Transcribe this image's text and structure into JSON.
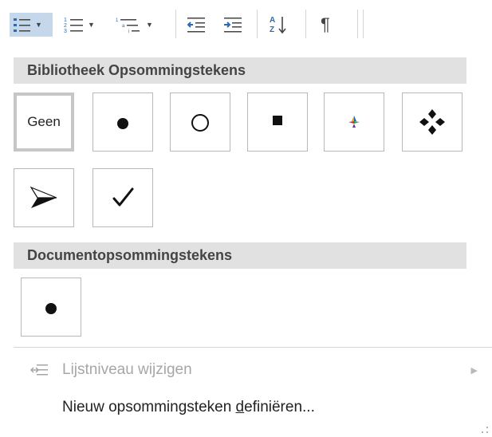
{
  "ribbon": {
    "bullets_button": "Opsommingstekens",
    "numbering_button": "Nummering",
    "multilevel_button": "Lijst met meerdere niveaus",
    "decrease_indent_button": "Inspringing verkleinen",
    "increase_indent_button": "Inspringing vergroten",
    "sort_button": "Sorteren",
    "show_marks_button": "¶"
  },
  "library": {
    "header": "Bibliotheek Opsommingstekens",
    "none_label": "Geen",
    "bullets": [
      "Geen",
      "●",
      "○",
      "■",
      "4-kleuren ruit",
      "❖",
      "➢",
      "✓"
    ]
  },
  "document": {
    "header": "Documentopsommingstekens",
    "bullets": [
      "●"
    ]
  },
  "actions": {
    "change_level": "Lijstniveau wijzigen",
    "define_new_prefix": "Nieuw opsommingsteken ",
    "define_new_accel": "d",
    "define_new_suffix": "efiniëren..."
  },
  "colors": {
    "header_bg": "#e1e1e1",
    "selected_button_bg": "#c5d7ea",
    "accent_blue": "#2b6cb0"
  }
}
